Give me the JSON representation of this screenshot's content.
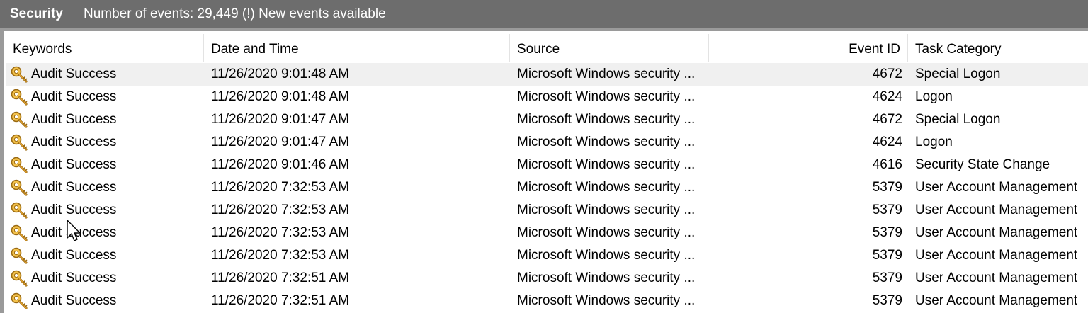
{
  "titlebar": {
    "log_name": "Security",
    "event_summary": "Number of events: 29,449 (!) New events available"
  },
  "columns": {
    "keywords": "Keywords",
    "date_time": "Date and Time",
    "source": "Source",
    "event_id": "Event ID",
    "task_category": "Task Category"
  },
  "rows": [
    {
      "keywords": "Audit Success",
      "date_time": "11/26/2020 9:01:48 AM",
      "source": "Microsoft Windows security ...",
      "event_id": "4672",
      "task_category": "Special Logon",
      "icon": "key-icon"
    },
    {
      "keywords": "Audit Success",
      "date_time": "11/26/2020 9:01:48 AM",
      "source": "Microsoft Windows security ...",
      "event_id": "4624",
      "task_category": "Logon",
      "icon": "key-icon"
    },
    {
      "keywords": "Audit Success",
      "date_time": "11/26/2020 9:01:47 AM",
      "source": "Microsoft Windows security ...",
      "event_id": "4672",
      "task_category": "Special Logon",
      "icon": "key-icon"
    },
    {
      "keywords": "Audit Success",
      "date_time": "11/26/2020 9:01:47 AM",
      "source": "Microsoft Windows security ...",
      "event_id": "4624",
      "task_category": "Logon",
      "icon": "key-icon"
    },
    {
      "keywords": "Audit Success",
      "date_time": "11/26/2020 9:01:46 AM",
      "source": "Microsoft Windows security ...",
      "event_id": "4616",
      "task_category": "Security State Change",
      "icon": "key-icon"
    },
    {
      "keywords": "Audit Success",
      "date_time": "11/26/2020 7:32:53 AM",
      "source": "Microsoft Windows security ...",
      "event_id": "5379",
      "task_category": "User Account Management",
      "icon": "key-icon"
    },
    {
      "keywords": "Audit Success",
      "date_time": "11/26/2020 7:32:53 AM",
      "source": "Microsoft Windows security ...",
      "event_id": "5379",
      "task_category": "User Account Management",
      "icon": "key-icon"
    },
    {
      "keywords": "Audit Success",
      "date_time": "11/26/2020 7:32:53 AM",
      "source": "Microsoft Windows security ...",
      "event_id": "5379",
      "task_category": "User Account Management",
      "icon": "key-icon"
    },
    {
      "keywords": "Audit Success",
      "date_time": "11/26/2020 7:32:53 AM",
      "source": "Microsoft Windows security ...",
      "event_id": "5379",
      "task_category": "User Account Management",
      "icon": "key-icon"
    },
    {
      "keywords": "Audit Success",
      "date_time": "11/26/2020 7:32:51 AM",
      "source": "Microsoft Windows security ...",
      "event_id": "5379",
      "task_category": "User Account Management",
      "icon": "key-icon"
    },
    {
      "keywords": "Audit Success",
      "date_time": "11/26/2020 7:32:51 AM",
      "source": "Microsoft Windows security ...",
      "event_id": "5379",
      "task_category": "User Account Management",
      "icon": "key-icon"
    }
  ],
  "colors": {
    "titlebar_bg": "#6d6d6d",
    "frame": "#9a9a9a",
    "selected_row": "#f0f0f0",
    "key_gold": "#e0a030"
  }
}
